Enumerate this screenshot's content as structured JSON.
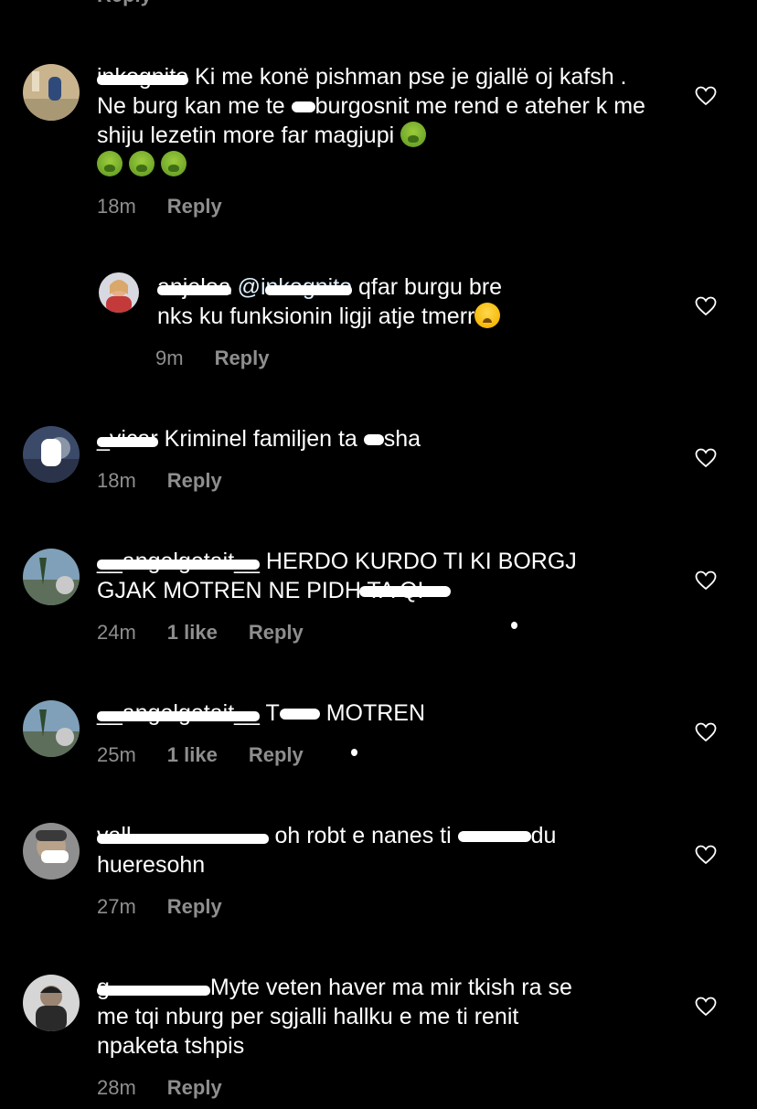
{
  "top_fragment": {
    "reply_label": "Reply"
  },
  "comments": [
    {
      "username": "inkognito",
      "text": "Ki me konë pishman pse je gjallë oj kafsh . Ne burg kan me te q burgosnit me rend e ateher k me shiju lezetin more far magjupi",
      "text_parts": [
        "Ki me konë pishman pse je gjallë oj kafsh . Ne burg kan me te ",
        "burgosnit me rend e ateher k me shiju lezetin more far magjupi "
      ],
      "time": "18m",
      "reply_label": "Reply",
      "emoji": [
        "nauseated-face",
        "nauseated-face",
        "nauseated-face",
        "nauseated-face"
      ]
    },
    {
      "username": "anjeloa",
      "mention": "@inkognito",
      "text_lines": [
        "qfar burgu bre",
        "nks ku funksionin ligji atje tmerr"
      ],
      "time": "9m",
      "reply_label": "Reply",
      "emoji": [
        "crying-face"
      ]
    },
    {
      "username": "_vicar",
      "text": "Kriminel familjen ta q sha",
      "text_parts": [
        "Kriminel familjen ta ",
        "sha"
      ],
      "time": "18m",
      "reply_label": "Reply"
    },
    {
      "username": "__angelgetait__",
      "text_lines": [
        "HERDO KURDO TI KI BORGJ",
        "GJAK MOTREN NE PIDH TA QI"
      ],
      "time": "24m",
      "likes": "1 like",
      "reply_label": "Reply"
    },
    {
      "username": "__angelgetait__",
      "text": "T MOTREN",
      "text_parts": [
        "T",
        "MOTREN"
      ],
      "time": "25m",
      "likes": "1 like",
      "reply_label": "Reply"
    },
    {
      "username": "vall",
      "text_lines": [
        "oh robt e nanes ti q du",
        "hueresohn"
      ],
      "text_parts": [
        "oh robt e nanes ti ",
        "du"
      ],
      "time": "27m",
      "reply_label": "Reply"
    },
    {
      "username": "g",
      "text_lines": [
        "Myte veten haver ma mir tkish ra se",
        "me tqi nburg  per sgjalli hallku e me ti renit",
        "npaketa tshpis"
      ],
      "time": "28m",
      "reply_label": "Reply"
    }
  ],
  "colors": {
    "background": "#000000",
    "text": "#ffffff",
    "meta": "#8e8e8e"
  }
}
